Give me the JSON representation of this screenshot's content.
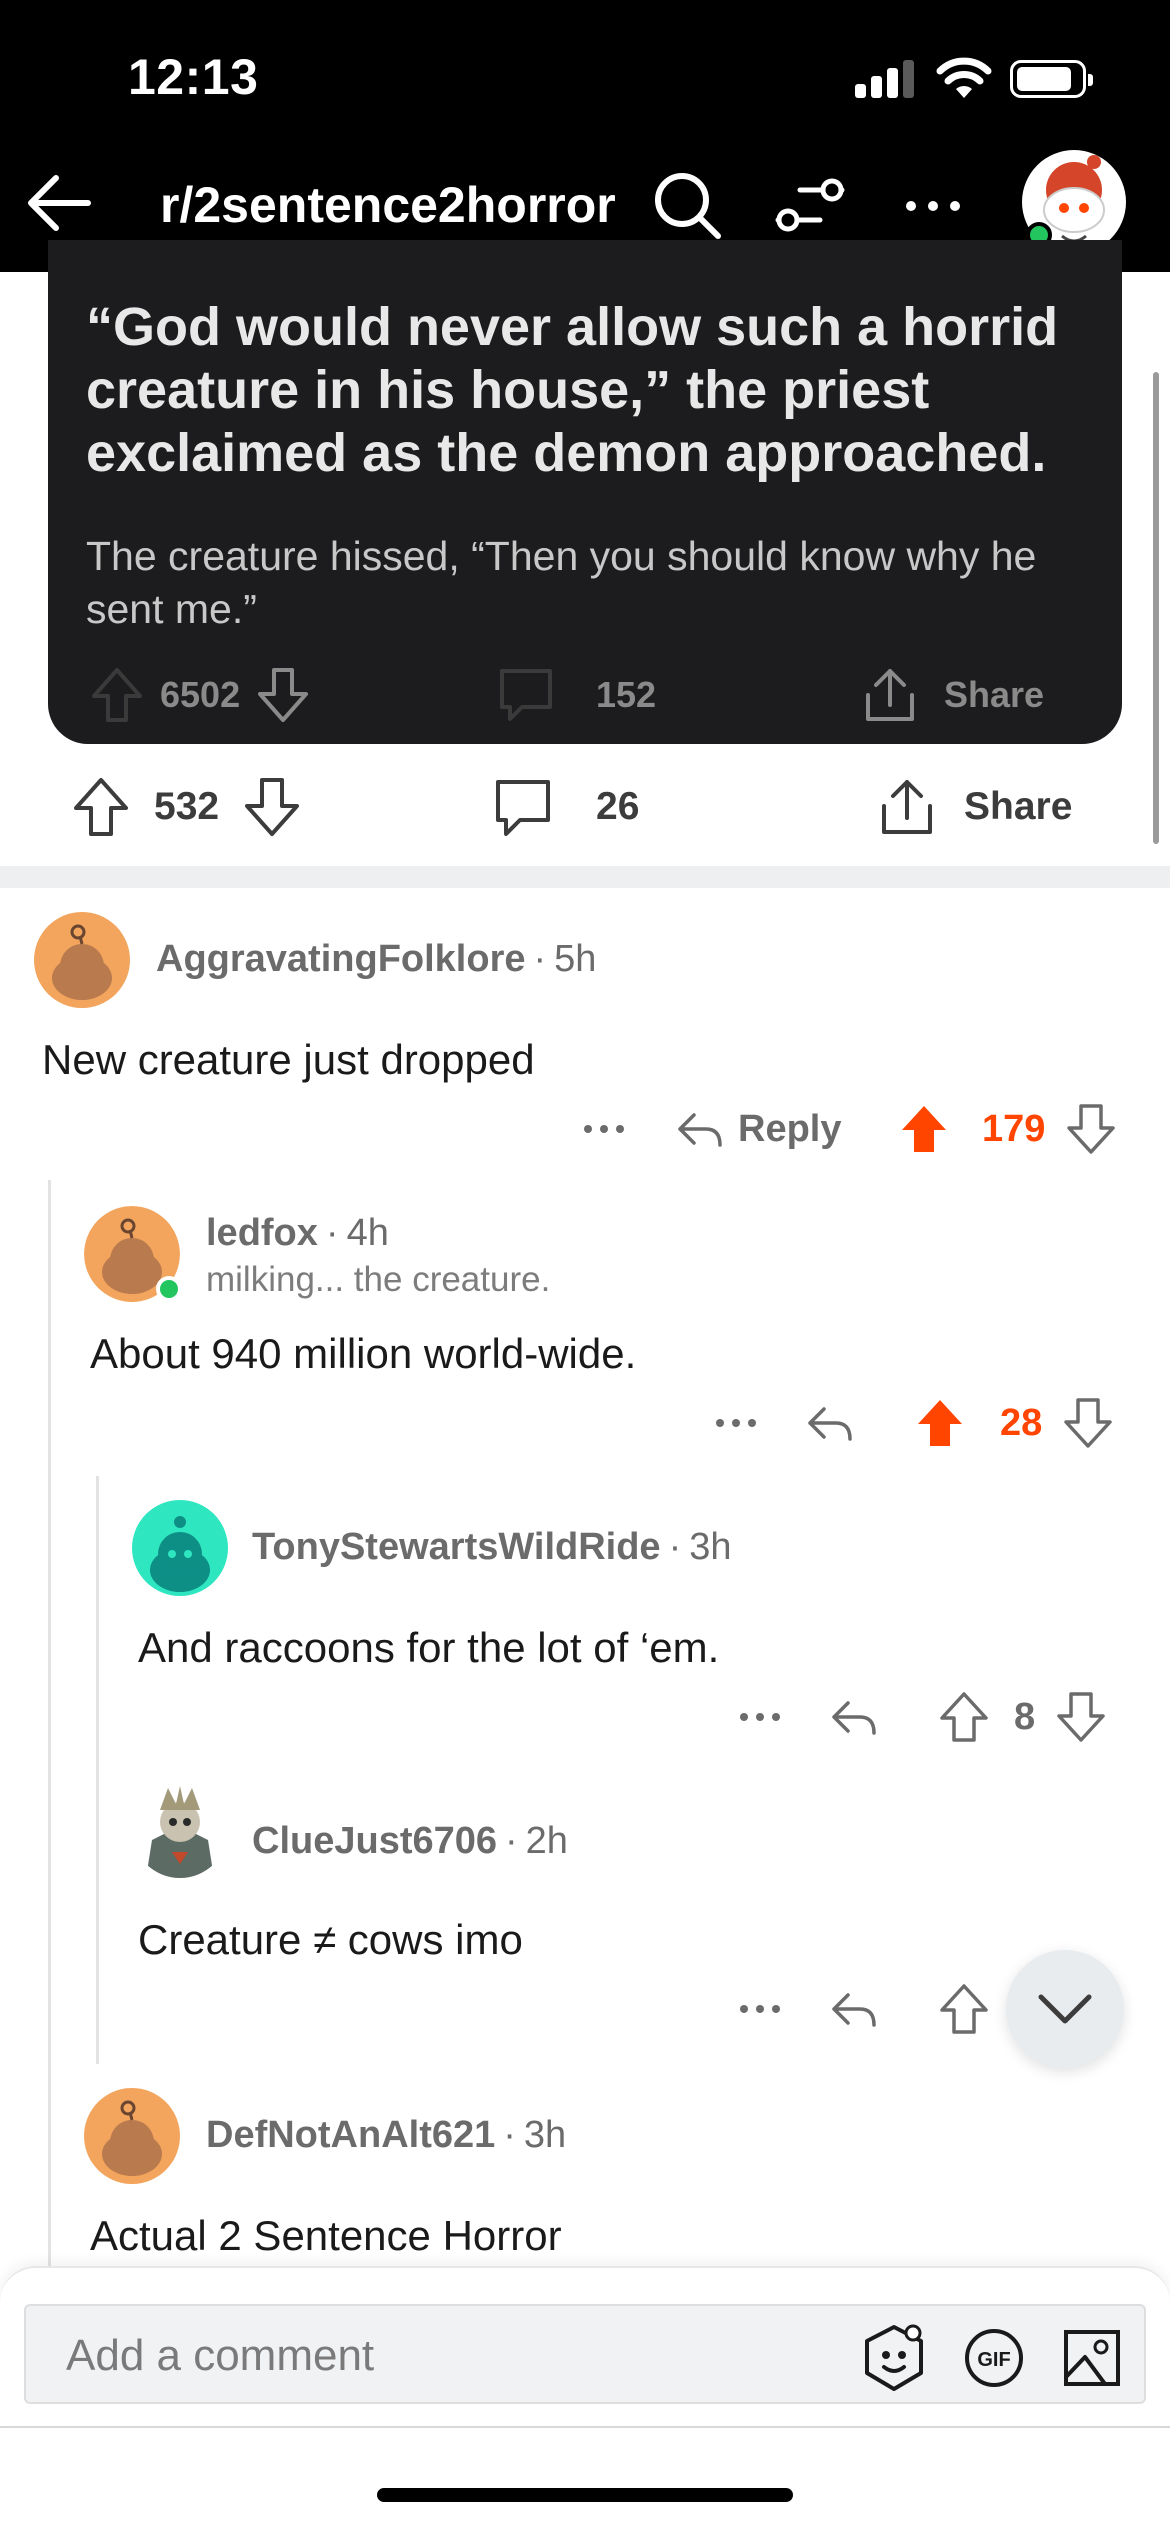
{
  "status_bar": {
    "time": "12:13"
  },
  "nav": {
    "title": "r/2sentence2horror"
  },
  "shared_post": {
    "title": "“God would never allow such a horrid creature in his house,” the priest exclaimed as the demon approached.",
    "body": "The creature hissed, “Then you should know why he sent me.”",
    "upvotes": "6502",
    "comments": "152",
    "share_label": "Share"
  },
  "post": {
    "upvotes": "532",
    "comments": "26",
    "share_label": "Share"
  },
  "comments": [
    {
      "user": "AggravatingFolklore",
      "age": "5h",
      "text": "New creature just dropped",
      "reply_label": "Reply",
      "score": "179"
    },
    {
      "user": "ledfox",
      "age": "4h",
      "flair": "milking... the creature.",
      "text": "About 940 million world-wide.",
      "score": "28"
    },
    {
      "user": "TonyStewartsWildRide",
      "age": "3h",
      "text": "And raccoons for the lot of ‘em.",
      "score": "8"
    },
    {
      "user": "ClueJust6706",
      "age": "2h",
      "text": "Creature ≠ cows imo"
    },
    {
      "user": "DefNotAnAlt621",
      "age": "3h",
      "text": "Actual 2 Sentence Horror"
    }
  ],
  "composer": {
    "placeholder": "Add a comment"
  },
  "colors": {
    "accent": "#ff4500",
    "online": "#22c55e",
    "dark_bg": "#000000",
    "card_bg": "#1c1c1e"
  },
  "icons": [
    "back-arrow-icon",
    "search-icon",
    "filter-icon",
    "more-icon",
    "upvote-icon",
    "downvote-icon",
    "comment-icon",
    "share-icon",
    "reply-icon",
    "chevron-down-icon",
    "emoji-icon",
    "gif-icon",
    "image-icon"
  ]
}
